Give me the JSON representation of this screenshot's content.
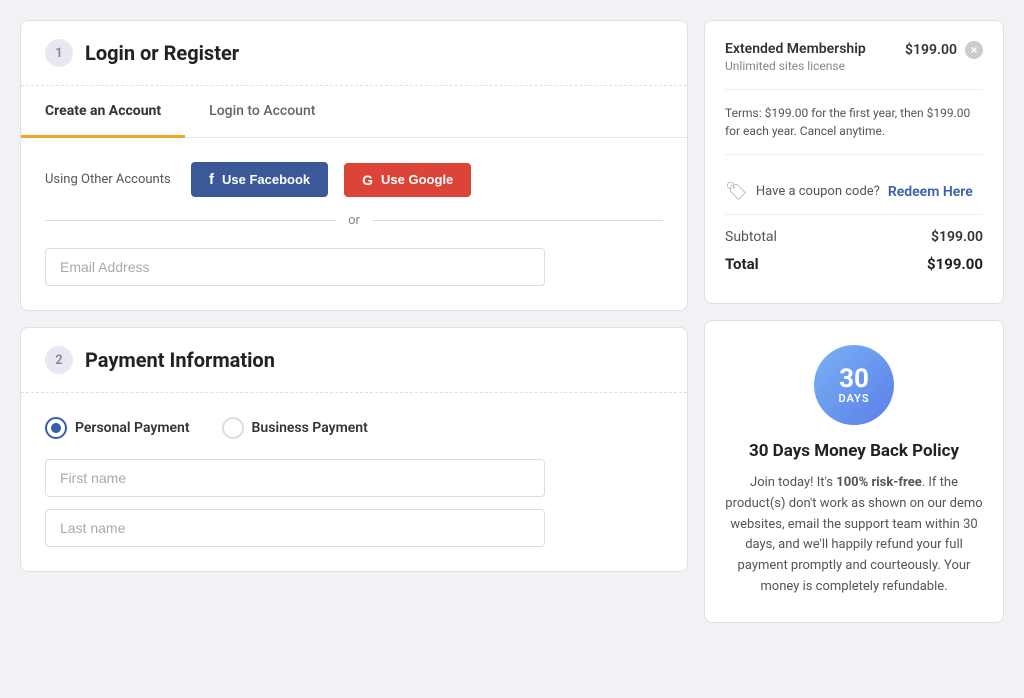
{
  "left": {
    "section1": {
      "step": "1",
      "title": "Login or Register",
      "tabs": [
        {
          "id": "create",
          "label": "Create an Account",
          "active": true
        },
        {
          "id": "login",
          "label": "Login to Account",
          "active": false
        }
      ],
      "social_label": "Using Other Accounts",
      "facebook_btn": "Use Facebook",
      "google_btn": "Use Google",
      "or_text": "or",
      "email_placeholder": "Email Address",
      "email_required": true
    },
    "section2": {
      "step": "2",
      "title": "Payment Information",
      "payment_options": [
        {
          "id": "personal",
          "label": "Personal Payment",
          "selected": true
        },
        {
          "id": "business",
          "label": "Business Payment",
          "selected": false
        }
      ],
      "fields": [
        {
          "placeholder": "First name",
          "required": true
        },
        {
          "placeholder": "Last name",
          "required": false
        }
      ]
    }
  },
  "right": {
    "order": {
      "item_name": "Extended Membership",
      "item_sub": "Unlimited sites license",
      "item_price": "$199.00",
      "terms": "Terms: $199.00 for the first year, then $199.00 for each year. Cancel anytime.",
      "coupon_text": "Have a coupon code?",
      "coupon_link": "Redeem Here",
      "subtotal_label": "Subtotal",
      "subtotal_value": "$199.00",
      "total_label": "Total",
      "total_value": "$199.00"
    },
    "money_back": {
      "days_num": "30",
      "days_label": "DAYS",
      "title": "30 Days Money Back Policy",
      "description": "Join today! It's 100% risk-free. If the product(s) don't work as shown on our demo websites, email the support team within 30 days, and we'll happily refund your full payment promptly and courteously. Your money is completely refundable."
    }
  }
}
